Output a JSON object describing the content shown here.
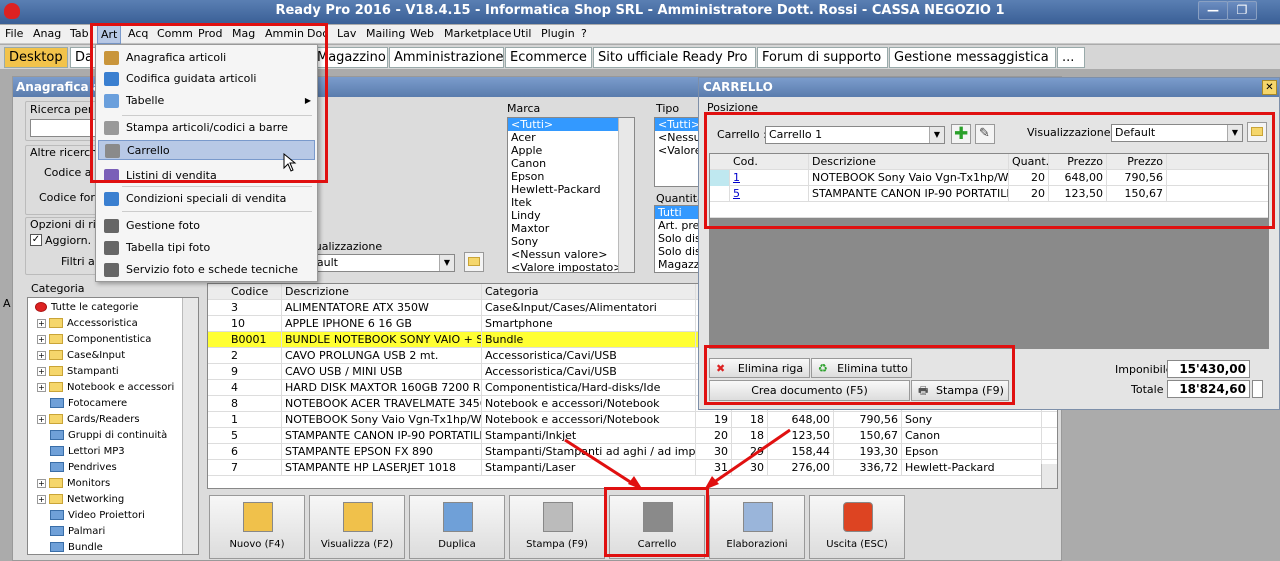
{
  "app": {
    "title": "Ready Pro 2016 - V18.4.15 - Informatica Shop SRL - Amministratore Dott. Rossi - CASSA NEGOZIO 1"
  },
  "window_buttons": {
    "min": "—",
    "max": "❐",
    "close": "✕"
  },
  "menubar": [
    "File",
    "Anag",
    "Tab",
    "Art",
    "Acq",
    "Comm",
    "Prod",
    "Mag",
    "Ammin",
    "Doc",
    "Lav",
    "Mailing",
    "Web",
    "Marketplace",
    "Util",
    "Plugin",
    "?"
  ],
  "tabs": [
    "Desktop",
    "Da",
    "Magazzino",
    "Amministrazione",
    "Ecommerce",
    "Sito ufficiale Ready Pro",
    "Forum di supporto",
    "Gestione messaggistica",
    "..."
  ],
  "art_menu": {
    "items": [
      {
        "label": "Anagrafica articoli",
        "icon": "box-icon"
      },
      {
        "label": "Codifica guidata articoli",
        "icon": "wizard-icon"
      },
      {
        "label": "Tabelle",
        "icon": "table-icon",
        "submenu": true
      },
      {
        "label": "Stampa articoli/codici a barre",
        "icon": "barcode-icon"
      },
      {
        "label": "Carrello",
        "icon": "cart-icon",
        "highlighted": true
      },
      {
        "label": "Listini di vendita",
        "icon": "pricelist-icon"
      },
      {
        "label": "Condizioni speciali di vendita",
        "icon": "conditions-icon"
      },
      {
        "label": "Gestione foto",
        "icon": "camera-icon"
      },
      {
        "label": "Tabella tipi foto",
        "icon": "camera-icon"
      },
      {
        "label": "Servizio foto e schede tecniche",
        "icon": "camera-icon"
      }
    ]
  },
  "anagrafica": {
    "title": "Anagrafica a",
    "ricerca_label": "Ricerca per",
    "altre_ricerche": "Altre ricerch",
    "codice_label": "Codice a ba",
    "codice_forn": "Codice forni",
    "opzioni": "Opzioni di rice",
    "aggiorn": "Aggiorn. a",
    "filtri": "Filtri avan",
    "visualizzazione_label": "sualizzazione",
    "visualizzazione_value": "fault",
    "marca_label": "Marca",
    "marca_items": [
      "<Tutti>",
      "Acer",
      "Apple",
      "Canon",
      "Epson",
      "Hewlett-Packard",
      "Itek",
      "Lindy",
      "Maxtor",
      "Sony",
      "<Nessun valore>",
      "<Valore impostato>"
    ],
    "tipo_label": "Tipo",
    "tipo_items": [
      "<Tutti>",
      "<Nessun",
      "<Valore"
    ],
    "quantita_label": "Quantità",
    "quantita_items": [
      "Tutti",
      "Art. pres",
      "Solo disp",
      "Solo disp",
      "Magazzin"
    ],
    "categoria_label": "Categoria",
    "categorie": [
      {
        "label": "Tutte le categorie",
        "root": true
      },
      {
        "label": "Accessoristica",
        "expand": true
      },
      {
        "label": "Componentistica",
        "expand": true
      },
      {
        "label": "Case&Input",
        "expand": true
      },
      {
        "label": "Stampanti",
        "expand": true
      },
      {
        "label": "Notebook e accessori",
        "expand": true
      },
      {
        "label": "Fotocamere",
        "expand": false
      },
      {
        "label": "Cards/Readers",
        "expand": true
      },
      {
        "label": "Gruppi di continuità",
        "expand": false
      },
      {
        "label": "Lettori MP3",
        "expand": false
      },
      {
        "label": "Pendrives",
        "expand": false
      },
      {
        "label": "Monitors",
        "expand": true
      },
      {
        "label": "Networking",
        "expand": true
      },
      {
        "label": "Video Proiettori",
        "expand": false
      },
      {
        "label": "Palmari",
        "expand": false
      },
      {
        "label": "Bundle",
        "expand": false
      }
    ],
    "side_letter": "A",
    "table_headers": [
      "Codice",
      "Descrizione",
      "Categoria",
      "C"
    ],
    "rows": [
      {
        "cod": "3",
        "desc": "ALIMENTATORE ATX 350W",
        "cat": "Case&Input/Cases/Alimentatori",
        "q1": "",
        "q2": "",
        "p1": "",
        "p2": "",
        "brand": ""
      },
      {
        "cod": "10",
        "desc": "APPLE IPHONE 6 16 GB",
        "cat": "Smartphone",
        "q1": "",
        "q2": "",
        "p1": "",
        "p2": "",
        "brand": ""
      },
      {
        "cod": "B0001",
        "desc": "BUNDLE NOTEBOOK SONY VAIO + ST...",
        "cat": "Bundle",
        "q1": "",
        "q2": "",
        "p1": "",
        "p2": "",
        "brand": "",
        "highlight": true
      },
      {
        "cod": "2",
        "desc": "CAVO PROLUNGA USB 2 mt.",
        "cat": "Accessoristica/Cavi/USB",
        "q1": "",
        "q2": "",
        "p1": "",
        "p2": "",
        "brand": ""
      },
      {
        "cod": "9",
        "desc": "CAVO USB / MINI USB",
        "cat": "Accessoristica/Cavi/USB",
        "q1": "",
        "q2": "",
        "p1": "",
        "p2": "",
        "brand": ""
      },
      {
        "cod": "4",
        "desc": "HARD DISK MAXTOR 160GB 7200 RP...",
        "cat": "Componentistica/Hard-disks/Ide",
        "q1": "",
        "q2": "",
        "p1": "",
        "p2": "",
        "brand": ""
      },
      {
        "cod": "8",
        "desc": "NOTEBOOK ACER TRAVELMATE 3456",
        "cat": "Notebook e accessori/Notebook",
        "q1": "",
        "q2": "",
        "p1": "",
        "p2": "",
        "brand": ""
      },
      {
        "cod": "1",
        "desc": "NOTEBOOK Sony Vaio Vgn-Tx1hp/W",
        "cat": "Notebook e accessori/Notebook",
        "q1": "19",
        "q2": "18",
        "p1": "648,00",
        "p2": "790,56",
        "brand": "Sony"
      },
      {
        "cod": "5",
        "desc": "STAMPANTE CANON IP-90 PORTATILE",
        "cat": "Stampanti/Inkjet",
        "q1": "20",
        "q2": "18",
        "p1": "123,50",
        "p2": "150,67",
        "brand": "Canon"
      },
      {
        "cod": "6",
        "desc": "STAMPANTE EPSON FX 890",
        "cat": "Stampanti/Stampanti ad aghi / ad imp...",
        "q1": "30",
        "q2": "29",
        "p1": "158,44",
        "p2": "193,30",
        "brand": "Epson"
      },
      {
        "cod": "7",
        "desc": "STAMPANTE HP LASERJET 1018",
        "cat": "Stampanti/Laser",
        "q1": "31",
        "q2": "30",
        "p1": "276,00",
        "p2": "336,72",
        "brand": "Hewlett-Packard"
      }
    ],
    "buttons": [
      {
        "label": "Nuovo (F4)",
        "icon": "new-icon"
      },
      {
        "label": "Visualizza (F2)",
        "icon": "view-icon"
      },
      {
        "label": "Duplica",
        "icon": "duplicate-icon"
      },
      {
        "label": "Stampa (F9)",
        "icon": "printer-icon"
      },
      {
        "label": "Carrello",
        "icon": "cart-icon"
      },
      {
        "label": "Elaborazioni",
        "icon": "process-icon"
      },
      {
        "label": "Uscita (ESC)",
        "icon": "exit-icon"
      }
    ]
  },
  "carrello": {
    "title": "CARRELLO",
    "posizione": "Posizione",
    "carrello_label": "Carrello :",
    "carrello_value": "Carrello 1",
    "vis_label": "Visualizzazione :",
    "vis_value": "Default",
    "headers": [
      "Cod.",
      "Descrizione",
      "Quant.",
      "Prezzo",
      "Prezzo"
    ],
    "rows": [
      {
        "cod": "1",
        "desc": "NOTEBOOK Sony Vaio Vgn-Tx1hp/W",
        "q": "20",
        "p1": "648,00",
        "p2": "790,56"
      },
      {
        "cod": "5",
        "desc": "STAMPANTE CANON IP-90 PORTATILE",
        "q": "20",
        "p1": "123,50",
        "p2": "150,67"
      }
    ],
    "elimina_riga": "Elimina riga",
    "elimina_tutto": "Elimina tutto",
    "crea_documento": "Crea documento (F5)",
    "stampa": "Stampa (F9)",
    "imponibile_label": "Imponibile",
    "imponibile_value": "15'430,00",
    "totale_label": "Totale",
    "totale_value": "18'824,60"
  },
  "colors": {
    "accent": "#e01010",
    "title": "#4a6ea5",
    "highlight": "#ffff33",
    "selection": "#3399ff"
  }
}
